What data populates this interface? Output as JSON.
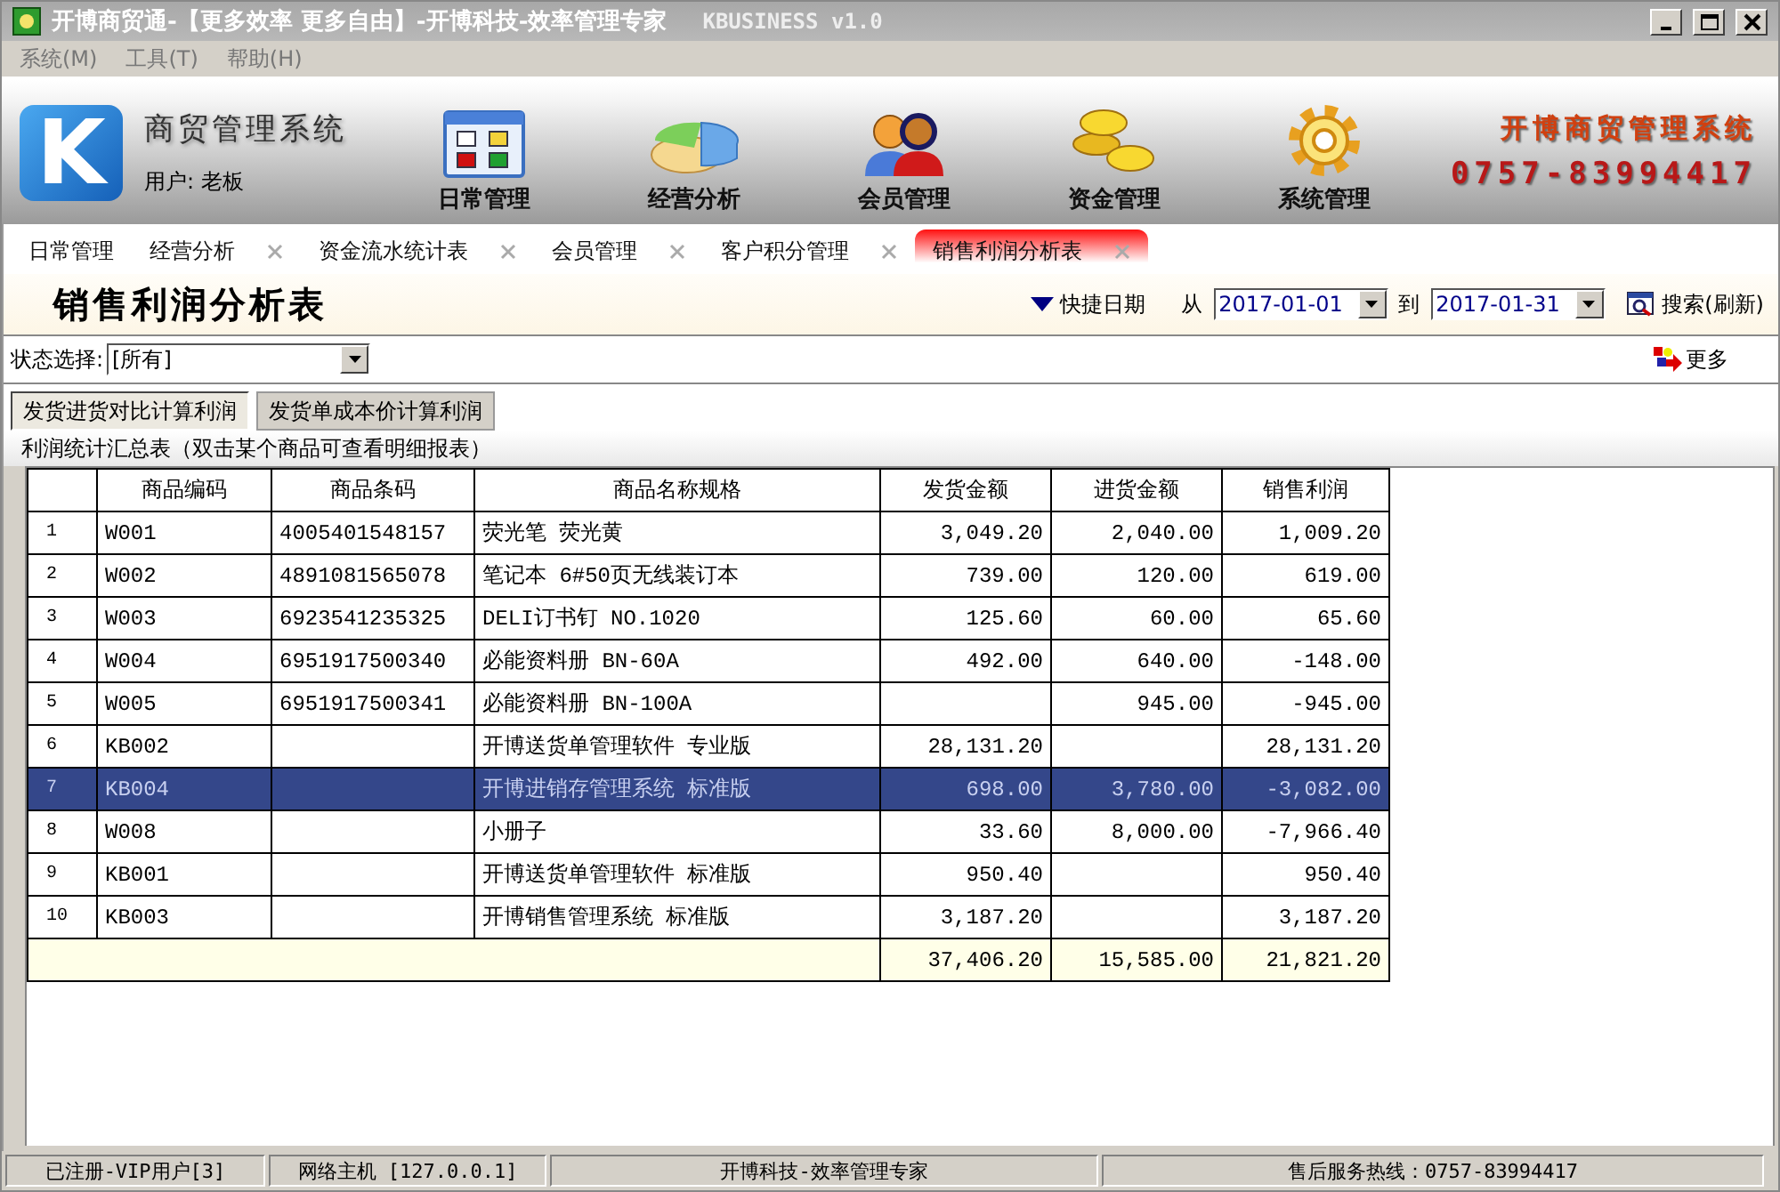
{
  "window": {
    "title": "开博商贸通-【更多效率 更多自由】-开博科技-效率管理专家",
    "version": "KBUSINESS v1.0"
  },
  "menu": [
    "系统(M)",
    "工具(T)",
    "帮助(H)"
  ],
  "header": {
    "logo_text": "K",
    "app_name": "商贸管理系统",
    "user": "用户: 老板",
    "modules": [
      {
        "label": "日常管理",
        "kind": "grid"
      },
      {
        "label": "经营分析",
        "kind": "pie"
      },
      {
        "label": "会员管理",
        "kind": "people"
      },
      {
        "label": "资金管理",
        "kind": "coins"
      },
      {
        "label": "系统管理",
        "kind": "gear"
      }
    ],
    "brand": "开博商贸管理系统",
    "hotline": "0757-83994417"
  },
  "tabs": [
    {
      "label": "日常管理",
      "closable": false,
      "selected": false
    },
    {
      "label": "经营分析",
      "closable": true,
      "selected": false
    },
    {
      "label": "资金流水统计表",
      "closable": true,
      "selected": false
    },
    {
      "label": "会员管理",
      "closable": true,
      "selected": false
    },
    {
      "label": "客户积分管理",
      "closable": true,
      "selected": false
    },
    {
      "label": "销售利润分析表",
      "closable": true,
      "selected": true
    }
  ],
  "report": {
    "title": "销售利润分析表",
    "quick_date": "快捷日期",
    "from_label": "从",
    "from": "2017-01-01",
    "to_label": "到",
    "to": "2017-01-31",
    "search": "搜索(刷新)",
    "status_label": "状态选择:",
    "status_value": "[所有]",
    "more": "更多",
    "modes": [
      {
        "label": "发货进货对比计算利润",
        "selected": true
      },
      {
        "label": "发货单成本价计算利润",
        "selected": false
      }
    ],
    "caption": "利润统计汇总表（双击某个商品可查看明细报表）"
  },
  "table": {
    "columns": [
      "商品编码",
      "商品条码",
      "商品名称规格",
      "发货金额",
      "进货金额",
      "销售利润"
    ],
    "rows": [
      {
        "no": "1",
        "cells": [
          "W001",
          "4005401548157",
          "荧光笔 荧光黄",
          "3,049.20",
          "2,040.00",
          "1,009.20"
        ],
        "selected": false
      },
      {
        "no": "2",
        "cells": [
          "W002",
          "4891081565078",
          "笔记本 6#50页无线装订本",
          "739.00",
          "120.00",
          "619.00"
        ],
        "selected": false
      },
      {
        "no": "3",
        "cells": [
          "W003",
          "6923541235325",
          "DELI订书钉 NO.1020",
          "125.60",
          "60.00",
          "65.60"
        ],
        "selected": false
      },
      {
        "no": "4",
        "cells": [
          "W004",
          "6951917500340",
          "必能资料册 BN-60A",
          "492.00",
          "640.00",
          "-148.00"
        ],
        "selected": false
      },
      {
        "no": "5",
        "cells": [
          "W005",
          "6951917500341",
          "必能资料册 BN-100A",
          "",
          "945.00",
          "-945.00"
        ],
        "selected": false
      },
      {
        "no": "6",
        "cells": [
          "KB002",
          "",
          "开博送货单管理软件 专业版",
          "28,131.20",
          "",
          "28,131.20"
        ],
        "selected": false
      },
      {
        "no": "7",
        "cells": [
          "KB004",
          "",
          "开博进销存管理系统 标准版",
          "698.00",
          "3,780.00",
          "-3,082.00"
        ],
        "selected": true
      },
      {
        "no": "8",
        "cells": [
          "W008",
          "",
          "小册子",
          "33.60",
          "8,000.00",
          "-7,966.40"
        ],
        "selected": false
      },
      {
        "no": "9",
        "cells": [
          "KB001",
          "",
          "开博送货单管理软件 标准版",
          "950.40",
          "",
          "950.40"
        ],
        "selected": false
      },
      {
        "no": "10",
        "cells": [
          "KB003",
          "",
          "开博销售管理系统 标准版",
          "3,187.20",
          "",
          "3,187.20"
        ],
        "selected": false
      }
    ],
    "totals": [
      "37,406.20",
      "15,585.00",
      "21,821.20"
    ]
  },
  "status_bar": [
    "已注册-VIP用户[3]",
    "网络主机 [127.0.0.1]",
    "开博科技-效率管理专家",
    "售后服务热线：0757-83994417"
  ]
}
